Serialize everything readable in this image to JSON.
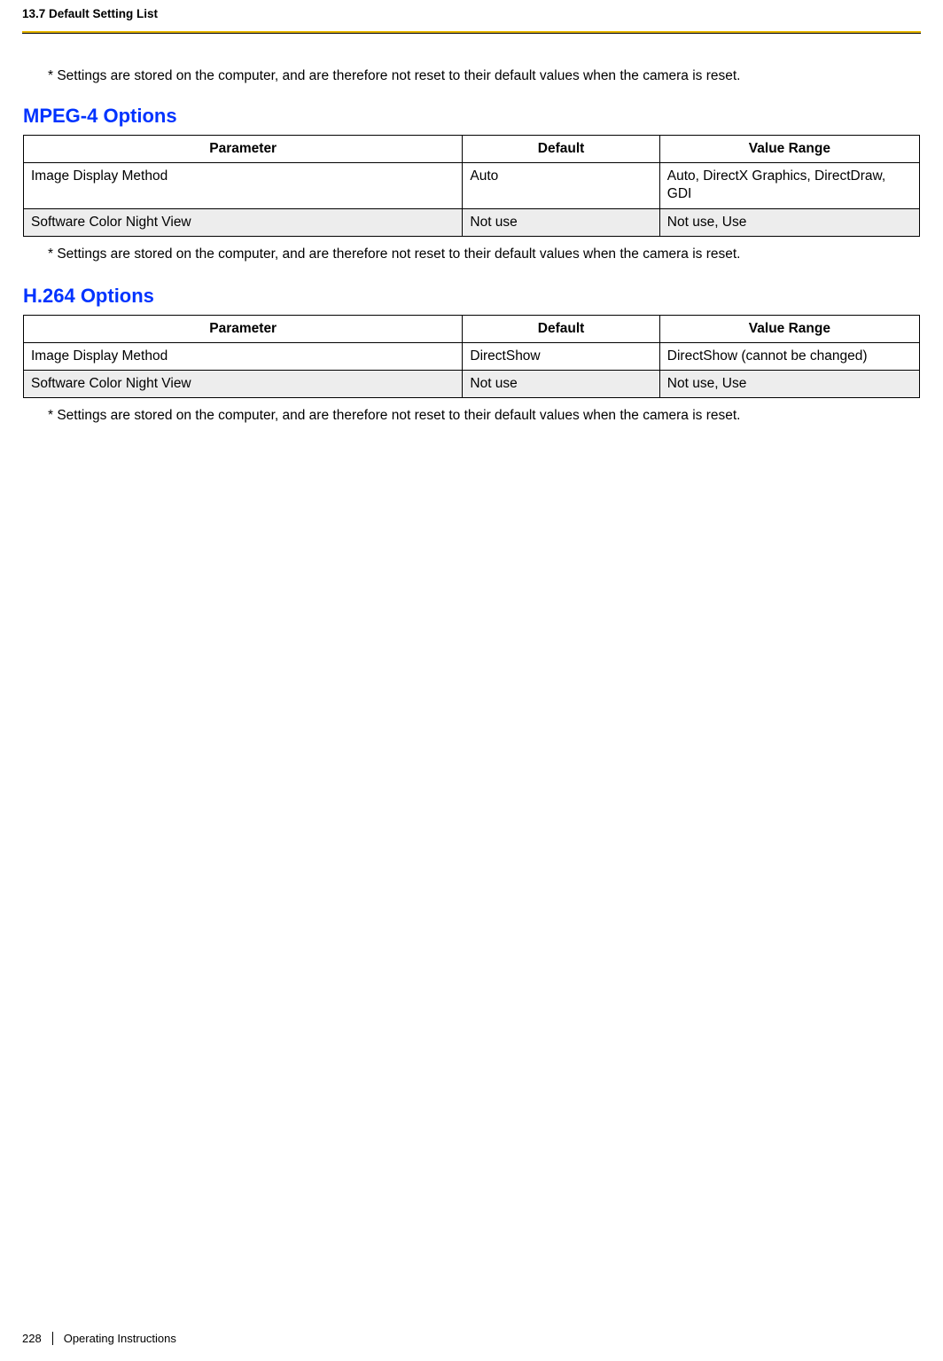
{
  "header": {
    "title": "13.7 Default Setting List"
  },
  "note_text": "* Settings are stored on the computer, and are therefore not reset to their default values when the camera is reset.",
  "columns": {
    "parameter": "Parameter",
    "default": "Default",
    "range": "Value Range"
  },
  "sections": [
    {
      "heading": "MPEG-4 Options",
      "rows": [
        {
          "parameter": "Image Display Method",
          "default": "Auto",
          "range": "Auto, DirectX Graphics, DirectDraw, GDI",
          "shaded": false
        },
        {
          "parameter": "Software Color Night View",
          "default": "Not use",
          "range": "Not use, Use",
          "shaded": true
        }
      ]
    },
    {
      "heading": "H.264 Options",
      "rows": [
        {
          "parameter": "Image Display Method",
          "default": "DirectShow",
          "range": "DirectShow (cannot be changed)",
          "shaded": false
        },
        {
          "parameter": "Software Color Night View",
          "default": "Not use",
          "range": "Not use, Use",
          "shaded": true
        }
      ]
    }
  ],
  "footer": {
    "page_number": "228",
    "doc_title": "Operating Instructions"
  }
}
